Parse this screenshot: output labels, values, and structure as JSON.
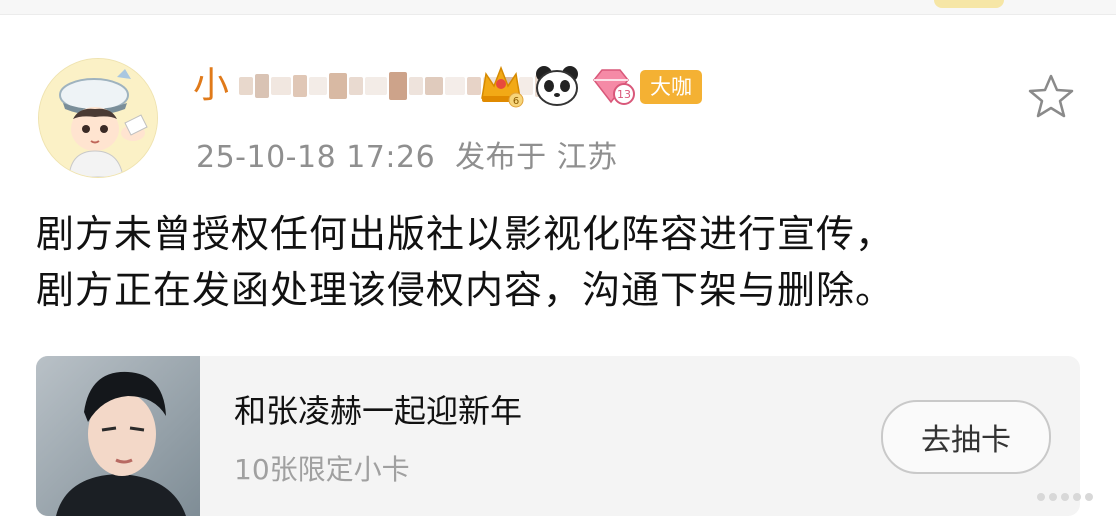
{
  "post": {
    "username": "小",
    "datetime": "25-10-18 17:26",
    "location": "发布于 江苏",
    "content_line1": "剧方未曾授权任何出版社以影视化阵容进行宣传，",
    "content_line2": "剧方正在发函处理该侵权内容，沟通下架与删除。"
  },
  "badges": {
    "crown_level": "6",
    "diamond_level": "13",
    "vip_label": "大咖"
  },
  "card": {
    "title": "和张凌赫一起迎新年",
    "subtitle": "10张限定小卡",
    "button_label": "去抽卡"
  },
  "colors": {
    "username": "#e07a1a",
    "badge_vip": "#f4b133",
    "meta_gray": "#8f8f8f",
    "card_bg": "#f4f4f4"
  }
}
